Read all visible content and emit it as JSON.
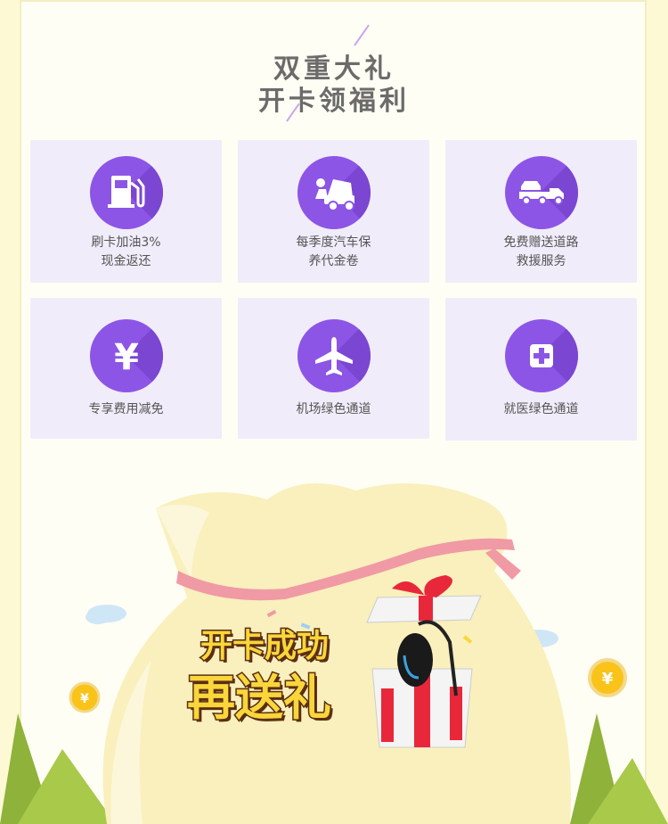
{
  "header": {
    "line1": "双重大礼",
    "line2": "开卡领福利"
  },
  "benefits": [
    {
      "icon": "fuel-pump-icon",
      "line1": "刷卡加油3%",
      "line2": "现金返还"
    },
    {
      "icon": "car-repair-icon",
      "line1": "每季度汽车保",
      "line2": "养代金卷"
    },
    {
      "icon": "tow-truck-icon",
      "line1": "免费赠送道路",
      "line2": "救援服务"
    },
    {
      "icon": "yen-icon",
      "line1": "专享费用减免",
      "line2": ""
    },
    {
      "icon": "airplane-icon",
      "line1": "机场绿色通道",
      "line2": ""
    },
    {
      "icon": "medical-cross-icon",
      "line1": "就医绿色通道",
      "line2": ""
    }
  ],
  "promo": {
    "line1": "开卡成功",
    "line2": "再送礼",
    "coin_symbol": "¥"
  },
  "colors": {
    "accent": "#8c55e6",
    "card_bg": "#f1ecfa",
    "page_bg": "#fffef4"
  }
}
